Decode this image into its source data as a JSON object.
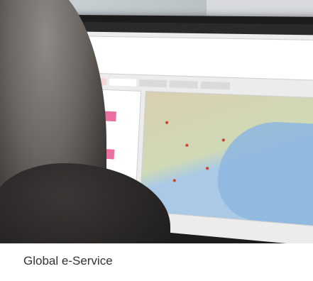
{
  "caption": "Global e-Service"
}
